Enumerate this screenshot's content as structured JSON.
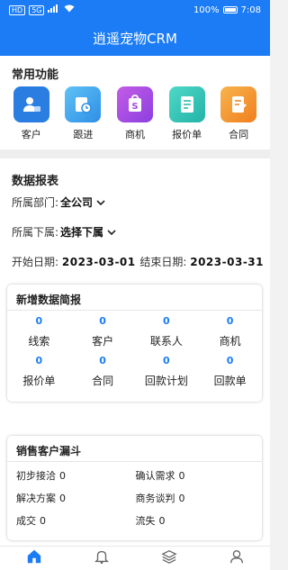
{
  "statusbar": {
    "left_chip1": "HD",
    "left_chip2": "5G",
    "battery": "100%",
    "time": "7:08"
  },
  "header": {
    "title": "逍遥宠物CRM"
  },
  "common": {
    "title": "常用功能",
    "items": [
      {
        "label": "客户",
        "icon": "customer-icon",
        "color": "#2a7de1"
      },
      {
        "label": "跟进",
        "icon": "followup-icon",
        "color": "#3aa0e8"
      },
      {
        "label": "商机",
        "icon": "opportunity-icon",
        "color": "#b04ce0"
      },
      {
        "label": "报价单",
        "icon": "quote-icon",
        "color": "#33c4b5"
      },
      {
        "label": "合同",
        "icon": "contract-icon",
        "color": "#f29a2e"
      }
    ]
  },
  "report": {
    "title": "数据报表",
    "dept_label": "所属部门:",
    "dept_value": "全公司",
    "sub_label": "所属下属:",
    "sub_value": "选择下属",
    "start_label": "开始日期:",
    "start_value": "2023-03-01",
    "end_label": "结束日期:",
    "end_value": "2023-03-31"
  },
  "brief": {
    "title": "新增数据简报",
    "items": [
      {
        "value": "0",
        "label": "线索"
      },
      {
        "value": "0",
        "label": "客户"
      },
      {
        "value": "0",
        "label": "联系人"
      },
      {
        "value": "0",
        "label": "商机"
      },
      {
        "value": "0",
        "label": "报价单"
      },
      {
        "value": "0",
        "label": "合同"
      },
      {
        "value": "0",
        "label": "回款计划"
      },
      {
        "value": "0",
        "label": "回款单"
      }
    ]
  },
  "funnel": {
    "title": "销售客户漏斗",
    "items": [
      {
        "label": "初步接洽",
        "value": "0"
      },
      {
        "label": "确认需求",
        "value": "0"
      },
      {
        "label": "解决方案",
        "value": "0"
      },
      {
        "label": "商务谈判",
        "value": "0"
      },
      {
        "label": "成交",
        "value": "0"
      },
      {
        "label": "流失",
        "value": "0"
      }
    ]
  },
  "tabbar": {
    "active_color": "#1b7cf5"
  }
}
